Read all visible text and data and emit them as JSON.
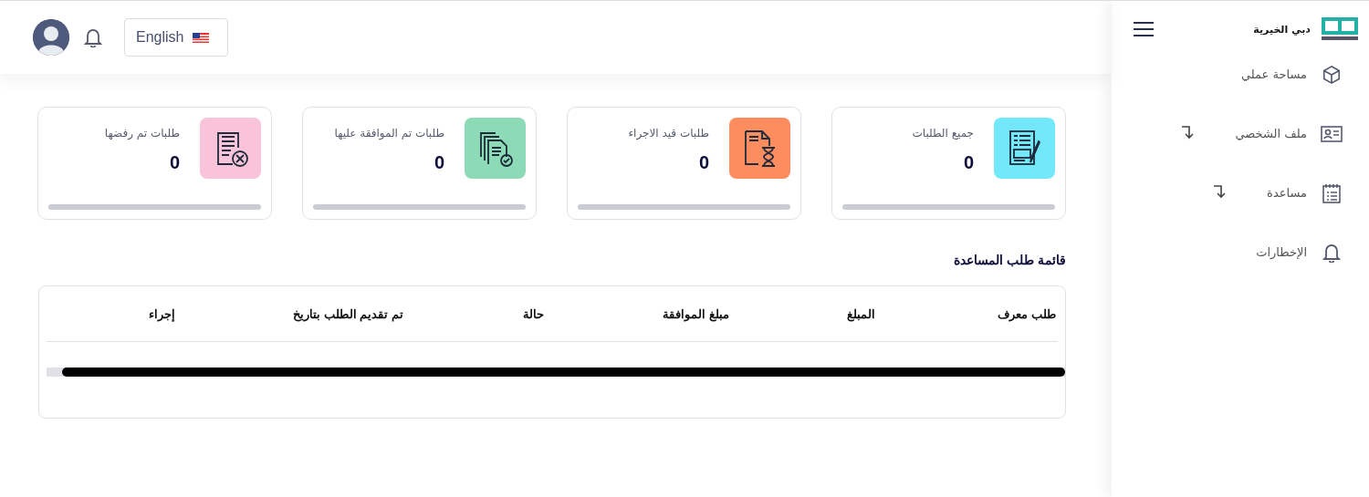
{
  "header": {
    "language": "English"
  },
  "sidebar": {
    "brand": "دبي الخيرية",
    "items": [
      {
        "label": "مساحة عملي",
        "kind": "cube",
        "expandable": false
      },
      {
        "label": "ملف الشخصي",
        "kind": "id-card",
        "expandable": true
      },
      {
        "label": "مساعدة",
        "kind": "notepad",
        "expandable": true
      },
      {
        "label": "الإخطارات",
        "kind": "bell",
        "expandable": false
      }
    ]
  },
  "stats": [
    {
      "label": "جميع الطلبات",
      "value": "0",
      "kind": "form",
      "color": "#74e8fb",
      "level": 0
    },
    {
      "label": "طلبات قيد الاجراء",
      "value": "0",
      "kind": "hourglass",
      "color": "#fd8c5e",
      "level": 0
    },
    {
      "label": "طلبات تم الموافقة عليها",
      "value": "0",
      "kind": "approved",
      "color": "#8ddbb6",
      "level": 0
    },
    {
      "label": "طلبات تم رفضها",
      "value": "0",
      "kind": "rejected",
      "color": "#f9c4d9",
      "level": 0
    }
  ],
  "section_title": "قائمة طلب المساعدة",
  "table": {
    "columns": [
      "طلب معرف",
      "المبلغ",
      "مبلغ الموافقة",
      "حالة",
      "تم تقديم الطلب بتاريخ",
      "إجراء"
    ]
  }
}
